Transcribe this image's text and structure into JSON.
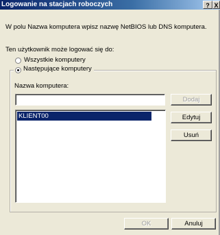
{
  "window": {
    "title": "Logowanie na stacjach roboczych",
    "help_glyph": "?",
    "close_glyph": "X"
  },
  "intro_text": "W polu Nazwa komputera wpisz nazwę NetBIOS lub DNS komputera.",
  "logon_label": "Ten użytkownik może logować się do:",
  "options": {
    "all": {
      "label": "Wszystkie komputery",
      "selected": false
    },
    "following": {
      "label": "Następujące komputery",
      "selected": true
    }
  },
  "computer_name": {
    "label": "Nazwa komputera:",
    "value": ""
  },
  "buttons": {
    "add": "Dodaj",
    "edit": "Edytuj",
    "remove": "Usuń",
    "ok": "OK",
    "cancel": "Anuluj"
  },
  "computers_list": [
    "KLIENT00"
  ]
}
